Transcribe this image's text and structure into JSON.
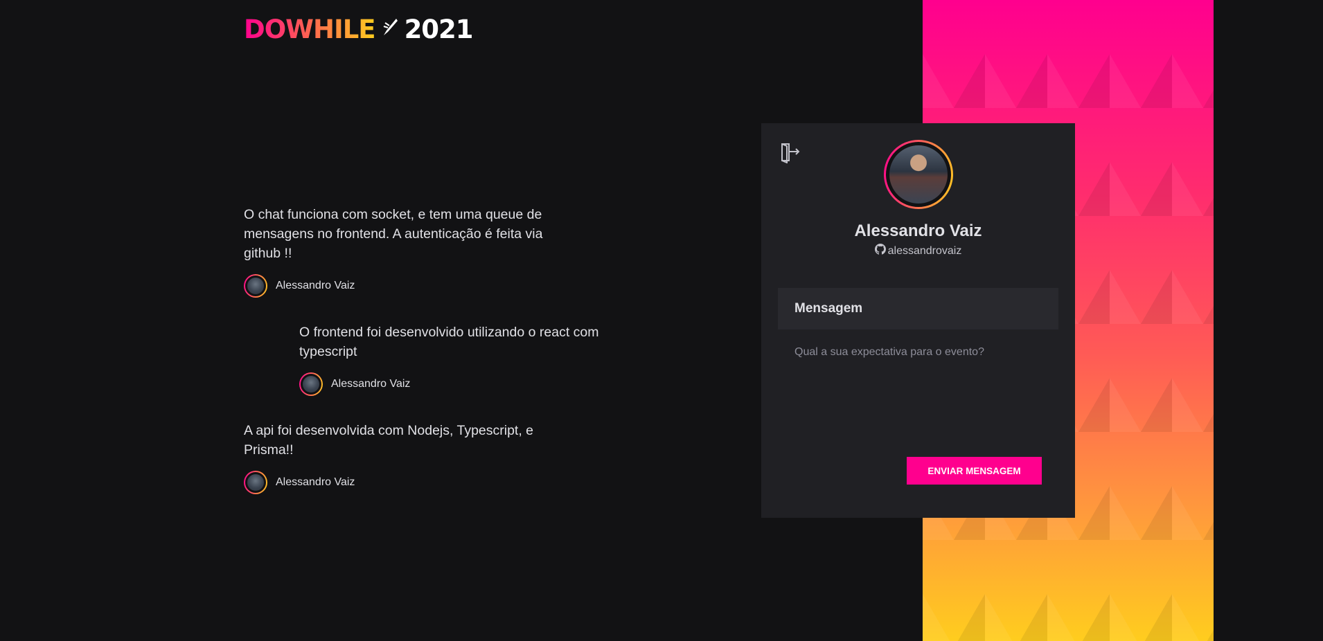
{
  "logo": {
    "part1": "DOWHILE",
    "spark": "⸝",
    "year": "2021"
  },
  "messages": [
    {
      "text": "O chat funciona com socket, e tem uma queue de mensagens no frontend. A autenticação é feita via github !!",
      "user": "Alessandro Vaiz"
    },
    {
      "text": "O frontend foi desenvolvido utilizando o react com typescript",
      "user": "Alessandro Vaiz"
    },
    {
      "text": "A api foi desenvolvida com Nodejs, Typescript, e Prisma!!",
      "user": "Alessandro Vaiz"
    }
  ],
  "profile": {
    "name": "Alessandro Vaiz",
    "login": "alessandrovaiz"
  },
  "form": {
    "header": "Mensagem",
    "placeholder": "Qual a sua expectativa para o evento?",
    "submit_label": "Enviar mensagem"
  },
  "colors": {
    "background": "#121214",
    "panel": "#202024",
    "accent": "#ff008e",
    "gradient_end": "#ffcd1e"
  },
  "icons": {
    "signout": "sign-out-icon",
    "github": "github-icon"
  }
}
